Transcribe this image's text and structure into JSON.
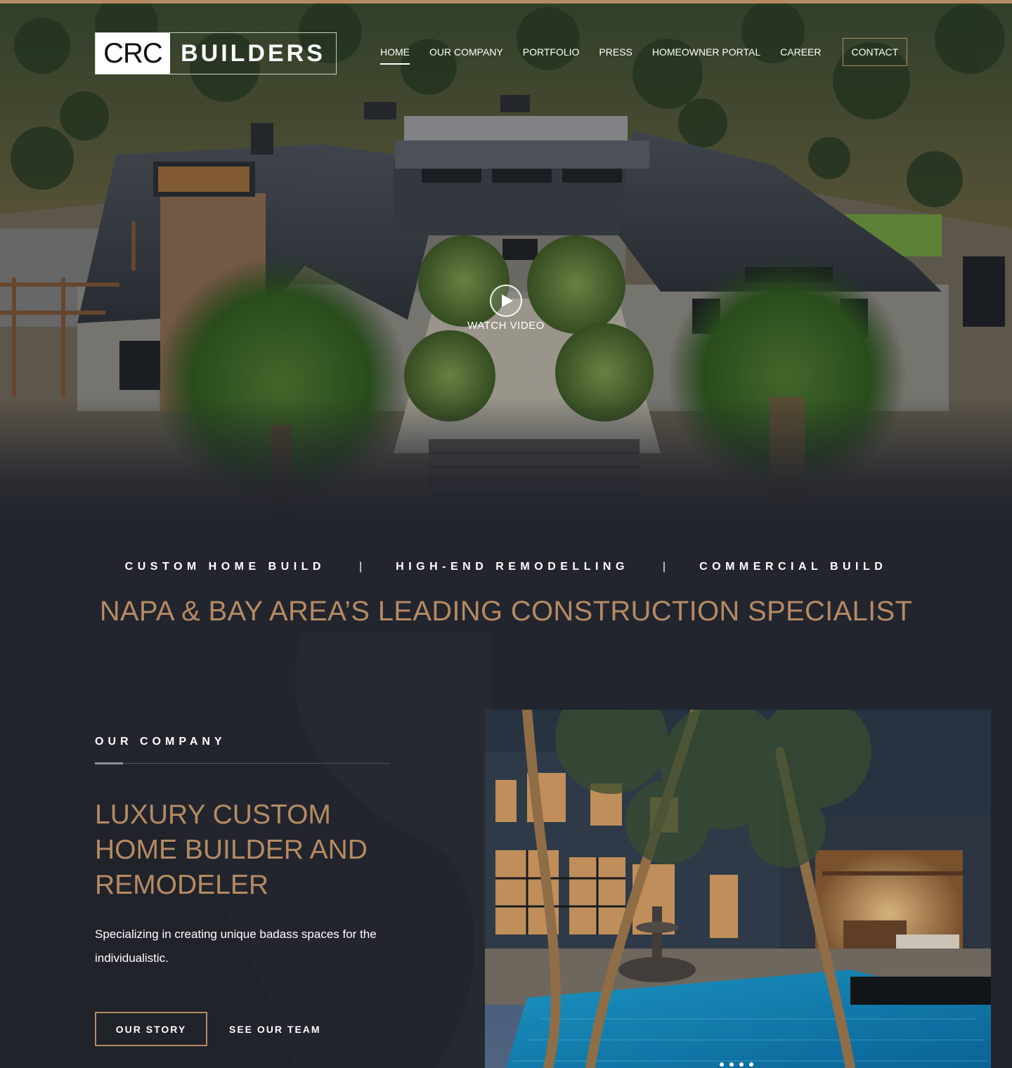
{
  "brand": {
    "logo_mark": "CRC",
    "logo_word": "BUILDERS",
    "accent": "#b58a63",
    "background": "#22252d"
  },
  "nav": {
    "items": [
      {
        "label": "HOME",
        "active": true
      },
      {
        "label": "OUR COMPANY"
      },
      {
        "label": "PORTFOLIO"
      },
      {
        "label": "PRESS"
      },
      {
        "label": "HOMEOWNER PORTAL"
      },
      {
        "label": "CAREER"
      }
    ],
    "contact_label": "CONTACT"
  },
  "hero": {
    "watch_label": "WATCH VIDEO",
    "play_icon": "play-icon"
  },
  "services": {
    "items": [
      "CUSTOM HOME BUILD",
      "HIGH-END REMODELLING",
      "COMMERCIAL BUILD"
    ],
    "separator": "|"
  },
  "headline": "NAPA & BAY AREA’S LEADING CONSTRUCTION SPECIALIST",
  "company": {
    "eyebrow": "OUR COMPANY",
    "title": "LUXURY CUSTOM HOME BUILDER AND REMODELER",
    "description": "Specializing in creating unique badass spaces for the individualistic.",
    "primary_button": "OUR STORY",
    "secondary_button": "SEE OUR TEAM"
  }
}
